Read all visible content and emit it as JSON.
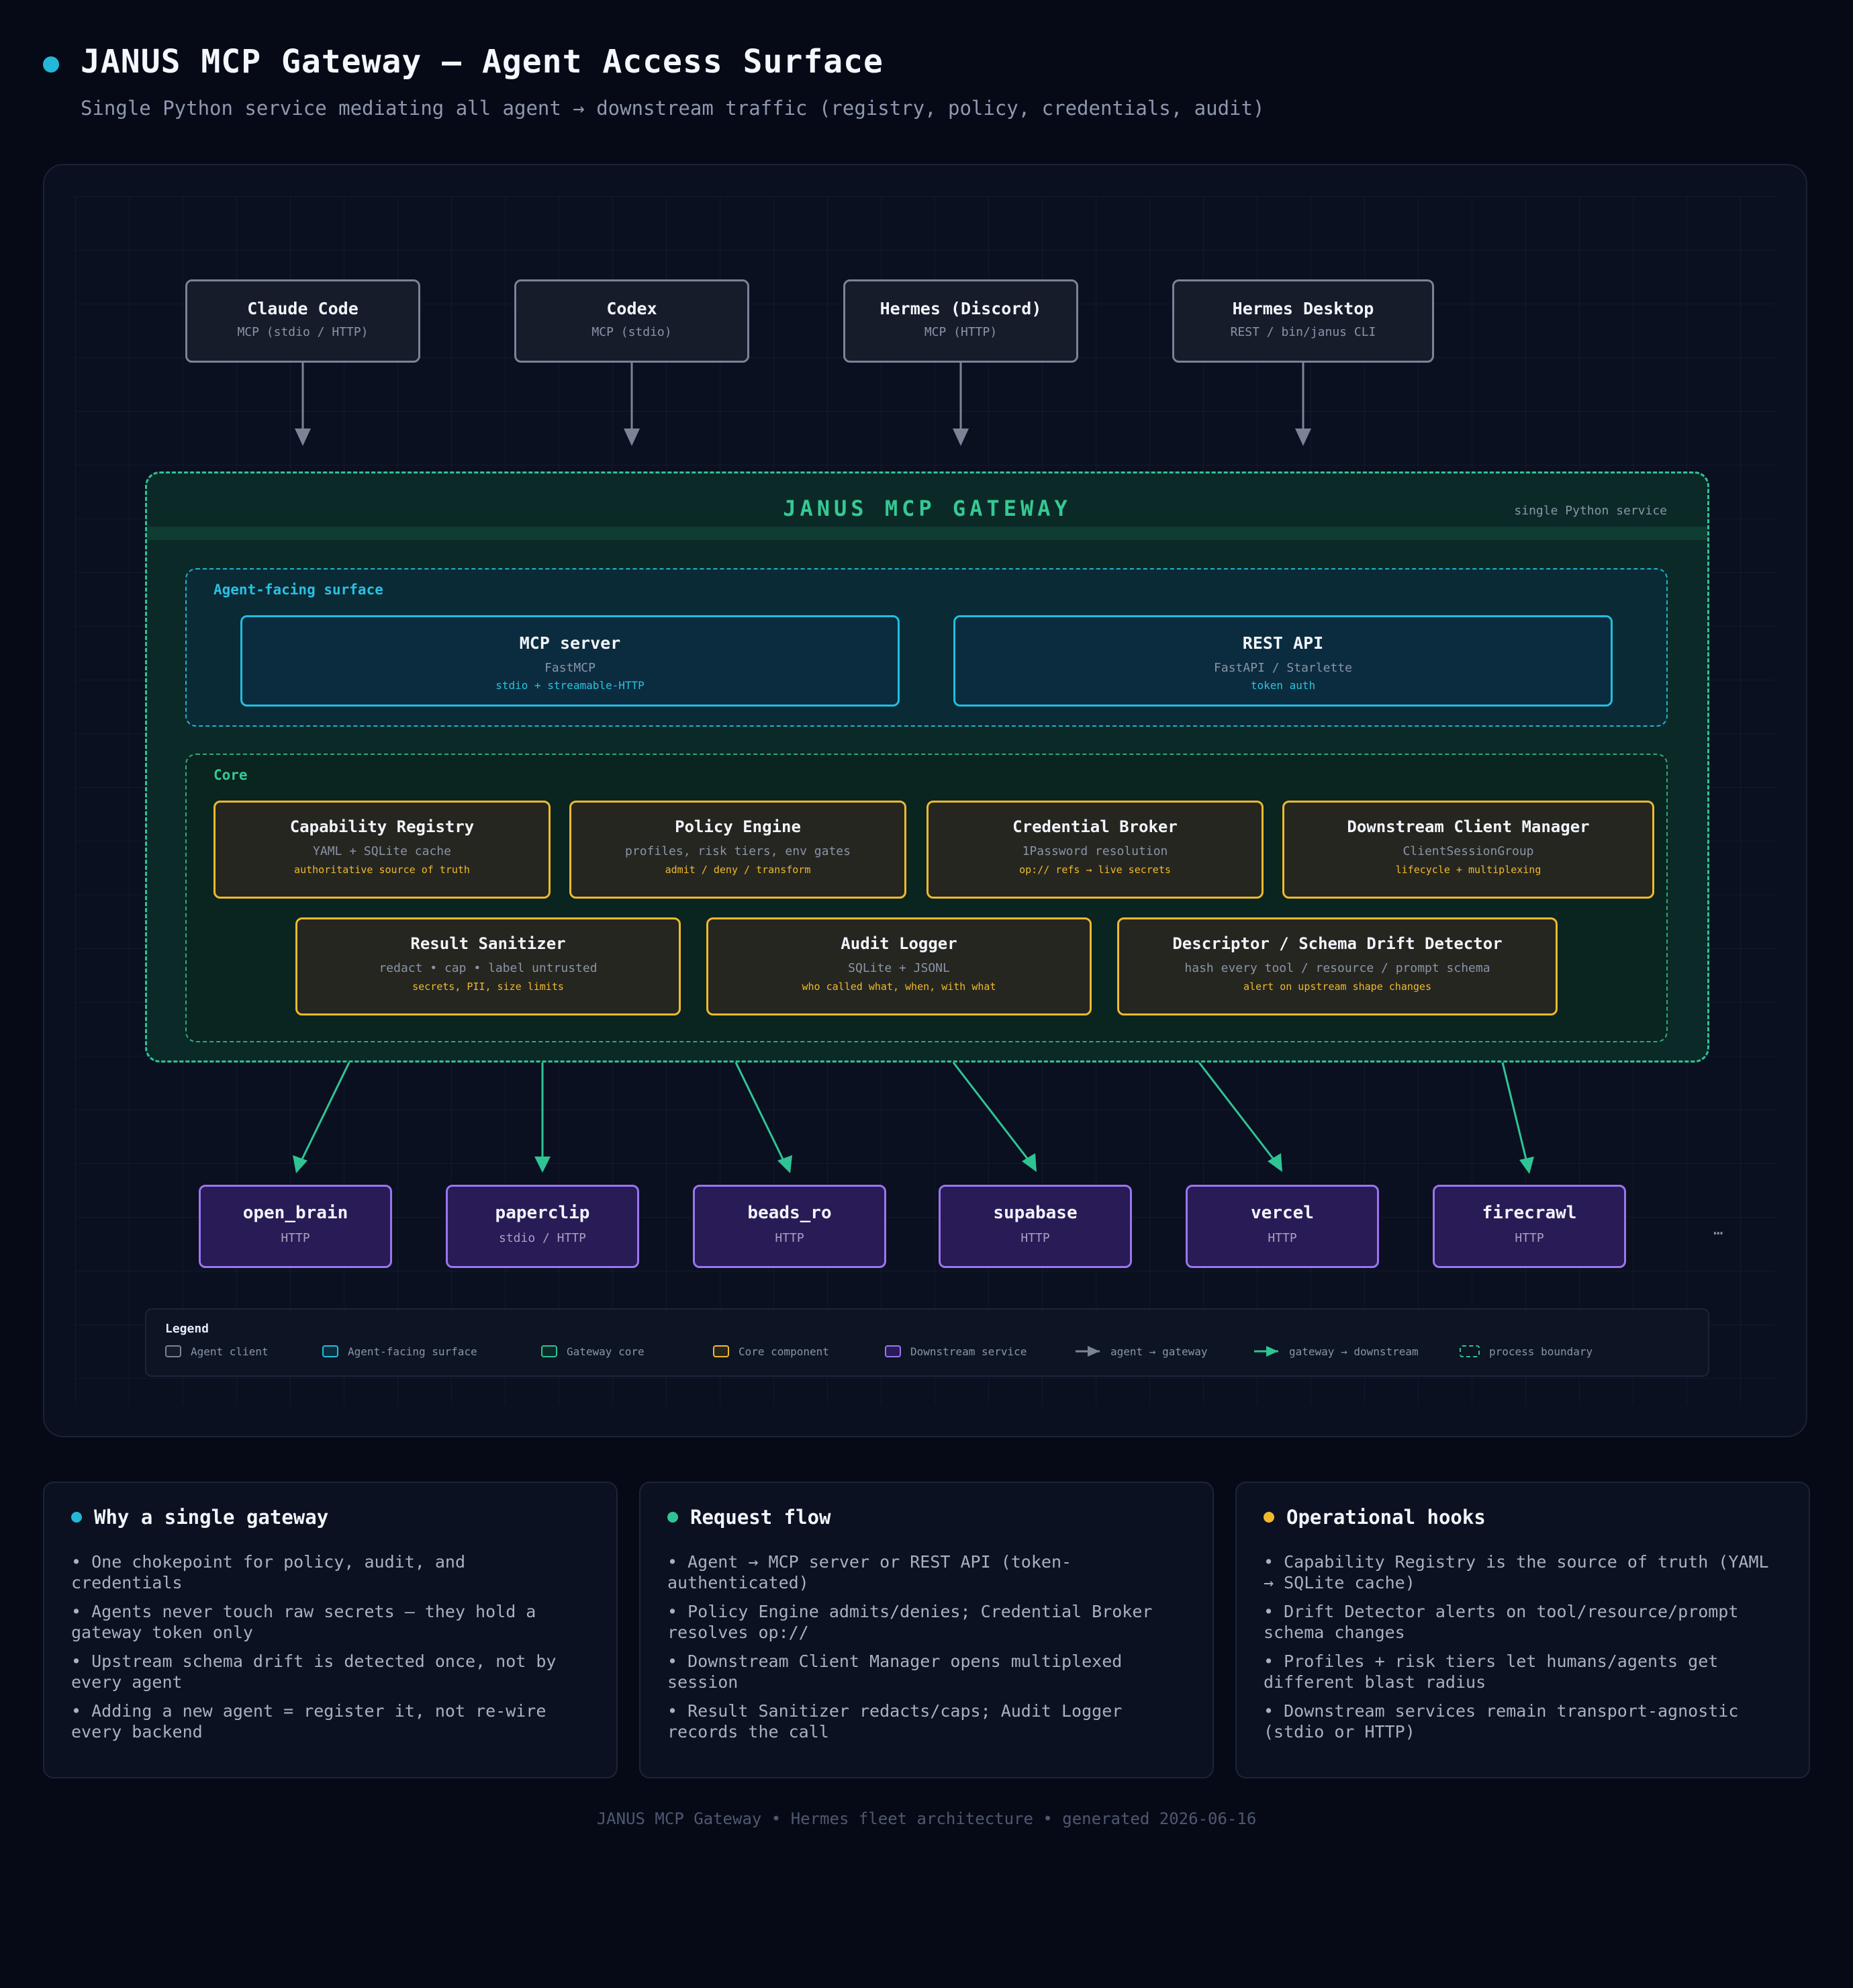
{
  "header": {
    "title": "JANUS MCP Gateway — Agent Access Surface",
    "subtitle": "Single Python service mediating all agent → downstream traffic (registry, policy, credentials, audit)"
  },
  "agents": [
    {
      "name": "Claude Code",
      "transport": "MCP (stdio / HTTP)"
    },
    {
      "name": "Codex",
      "transport": "MCP (stdio)"
    },
    {
      "name": "Hermes (Discord)",
      "transport": "MCP (HTTP)"
    },
    {
      "name": "Hermes Desktop",
      "transport": "REST / bin/janus CLI"
    }
  ],
  "gateway": {
    "title": "JANUS MCP GATEWAY",
    "note": "single Python service",
    "surface": {
      "label": "Agent-facing surface",
      "items": [
        {
          "name": "MCP server",
          "sub": "FastMCP",
          "tag": "stdio + streamable-HTTP"
        },
        {
          "name": "REST API",
          "sub": "FastAPI / Starlette",
          "tag": "token auth"
        }
      ]
    },
    "core": {
      "label": "Core",
      "row1": [
        {
          "name": "Capability Registry",
          "sub": "YAML + SQLite cache",
          "tag": "authoritative source of truth"
        },
        {
          "name": "Policy Engine",
          "sub": "profiles, risk tiers, env gates",
          "tag": "admit / deny / transform"
        },
        {
          "name": "Credential Broker",
          "sub": "1Password resolution",
          "tag": "op:// refs → live secrets"
        },
        {
          "name": "Downstream Client Manager",
          "sub": "ClientSessionGroup",
          "tag": "lifecycle + multiplexing"
        }
      ],
      "row2": [
        {
          "name": "Result Sanitizer",
          "sub": "redact • cap • label untrusted",
          "tag": "secrets, PII, size limits"
        },
        {
          "name": "Audit Logger",
          "sub": "SQLite + JSONL",
          "tag": "who called what, when, with what"
        },
        {
          "name": "Descriptor / Schema Drift Detector",
          "sub": "hash every tool / resource / prompt schema",
          "tag": "alert on upstream shape changes"
        }
      ]
    }
  },
  "downstream": {
    "services": [
      {
        "name": "open_brain",
        "transport": "HTTP"
      },
      {
        "name": "paperclip",
        "transport": "stdio / HTTP"
      },
      {
        "name": "beads_ro",
        "transport": "HTTP"
      },
      {
        "name": "supabase",
        "transport": "HTTP"
      },
      {
        "name": "vercel",
        "transport": "HTTP"
      },
      {
        "name": "firecrawl",
        "transport": "HTTP"
      }
    ],
    "more": "…"
  },
  "legend": {
    "title": "Legend",
    "items": [
      {
        "label": "Agent client",
        "icon": "swatch",
        "fill": "#161c2a",
        "stroke": "#7b8396"
      },
      {
        "label": "Agent-facing surface",
        "icon": "swatch",
        "fill": "#0b2c3e",
        "stroke": "#21bfe0"
      },
      {
        "label": "Gateway core",
        "icon": "swatch",
        "fill": "#0b2a27",
        "stroke": "#2fc493"
      },
      {
        "label": "Core component",
        "icon": "swatch",
        "fill": "#252620",
        "stroke": "#f0b92d"
      },
      {
        "label": "Downstream service",
        "icon": "swatch",
        "fill": "#291b56",
        "stroke": "#9a76f0"
      },
      {
        "label": "agent → gateway",
        "icon": "arrow",
        "stroke": "#7b8396"
      },
      {
        "label": "gateway → downstream",
        "icon": "arrow",
        "stroke": "#2fc493"
      },
      {
        "label": "process boundary",
        "icon": "dashed",
        "stroke": "#2fc493"
      }
    ]
  },
  "cards": [
    {
      "title": "Why a single gateway",
      "dot_color": "#23b7d8",
      "items": [
        "• One chokepoint for policy, audit, and credentials",
        "• Agents never touch raw secrets — they hold a gateway token only",
        "• Upstream schema drift is detected once, not by every agent",
        "• Adding a new agent = register it, not re-wire every backend"
      ]
    },
    {
      "title": "Request flow",
      "dot_color": "#2fc493",
      "items": [
        "• Agent → MCP server or REST API (token-authenticated)",
        "• Policy Engine admits/denies; Credential Broker resolves op://",
        "• Downstream Client Manager opens multiplexed session",
        "• Result Sanitizer redacts/caps; Audit Logger records the call"
      ]
    },
    {
      "title": "Operational hooks",
      "dot_color": "#f0b92d",
      "items": [
        "• Capability Registry is the source of truth (YAML → SQLite cache)",
        "• Drift Detector alerts on tool/resource/prompt schema changes",
        "• Profiles + risk tiers let humans/agents get different blast radius",
        "• Downstream services remain transport-agnostic (stdio or HTTP)"
      ]
    }
  ],
  "footer": "JANUS MCP Gateway • Hermes fleet architecture • generated 2026-06-16"
}
